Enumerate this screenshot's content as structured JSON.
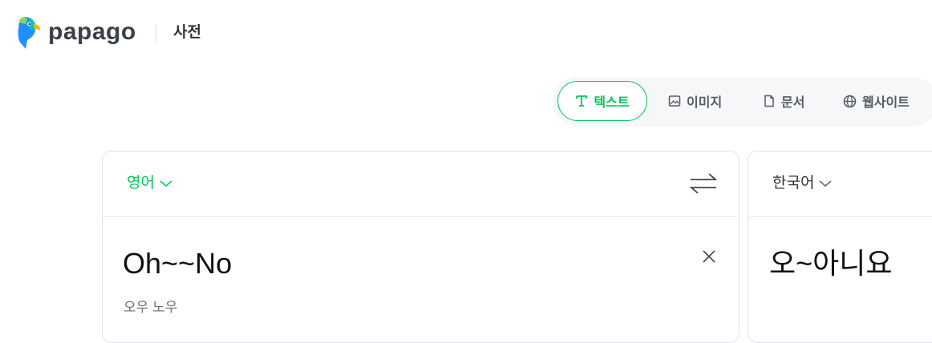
{
  "header": {
    "logo_text": "papago",
    "dict_label": "사전"
  },
  "modes": [
    {
      "label": "텍스트",
      "icon": "text-icon",
      "active": true
    },
    {
      "label": "이미지",
      "icon": "image-icon",
      "active": false
    },
    {
      "label": "문서",
      "icon": "document-icon",
      "active": false
    },
    {
      "label": "웹사이트",
      "icon": "globe-icon",
      "active": false
    }
  ],
  "source": {
    "language": "영어",
    "text": "Oh~~No",
    "pronunciation": "오우 노우"
  },
  "target": {
    "language": "한국어",
    "text": "오~아니요"
  },
  "colors": {
    "accent": "#03c75a",
    "logo_blue": "#1e90ff",
    "logo_dark": "#3b4048"
  }
}
